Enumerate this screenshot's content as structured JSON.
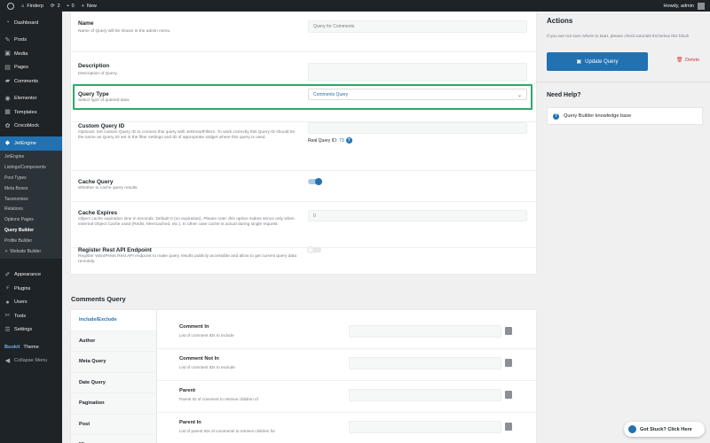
{
  "adminbar": {
    "site_name": "Finderp",
    "updates_count": "2",
    "comments_count": "0",
    "new_label": "New",
    "howdy": "Howdy, admin"
  },
  "sidebar": {
    "items": [
      {
        "label": "Dashboard",
        "icon": "dashboard-icon"
      },
      {
        "label": "Posts",
        "icon": "pin-icon"
      },
      {
        "label": "Media",
        "icon": "media-icon"
      },
      {
        "label": "Pages",
        "icon": "page-icon"
      },
      {
        "label": "Comments",
        "icon": "comment-icon"
      },
      {
        "label": "Elementor",
        "icon": "elementor-icon"
      },
      {
        "label": "Templates",
        "icon": "folder-icon"
      },
      {
        "label": "Crocoblock",
        "icon": "crocoblock-icon"
      },
      {
        "label": "JetEngine",
        "icon": "jetengine-icon"
      }
    ],
    "submenu": [
      "JetEngine",
      "Listings/Components",
      "Post Types",
      "Meta Boxes",
      "Taxonomies",
      "Relations",
      "Options Pages",
      "Query Builder",
      "Profile Builder",
      "Website Builder"
    ],
    "lower_items": [
      {
        "label": "Appearance",
        "icon": "brush-icon"
      },
      {
        "label": "Plugins",
        "icon": "plugin-icon"
      },
      {
        "label": "Users",
        "icon": "user-icon"
      },
      {
        "label": "Tools",
        "icon": "tools-icon"
      },
      {
        "label": "Settings",
        "icon": "settings-icon"
      }
    ],
    "theme_brand": "Bookit",
    "theme_label": "Theme",
    "collapse": "Collapse Menu"
  },
  "form": {
    "name_label": "Name",
    "name_desc": "Name of Query will be shown in the admin menu.",
    "name_placeholder": "Query for Comments",
    "description_label": "Description",
    "description_desc": "Description of Query.",
    "query_type_label": "Query Type",
    "query_type_desc": "Select type of queried data.",
    "query_type_value": "Comments Query",
    "custom_id_label": "Custom Query ID",
    "custom_id_desc": "Optional. Set custom Query ID to connect this query with JetSmartFilters. To work correctly this Query ID should be the same as Query ID set in the filter settings and ID of appropriate widget where this query is used.",
    "real_id_label": "Real Query ID:",
    "real_id_value": "73",
    "cache_label": "Cache Query",
    "cache_desc": "Whether to cache query results.",
    "cache_on": true,
    "expires_label": "Cache Expires",
    "expires_desc": "Object cache expiration time in seconds. Default 0 (no expiration). Please note: this option makes sence only when external Object Cache used (Redis, Memcached, etc.). In other case cache is actual during single request.",
    "expires_placeholder": "0",
    "rest_label": "Register Rest API Endpoint",
    "rest_desc": "Register WordPress Rest API endpoint to make query results publicly accessible and allow to get current query data remotely.",
    "rest_on": false
  },
  "actions": {
    "title": "Actions",
    "note": "If you are not sure where to start, please check tutorials list below this block",
    "update": "Update Query",
    "delete": "Delete",
    "help_title": "Need Help?",
    "help_link": "Query Builder knowledge base"
  },
  "comments_query": {
    "title": "Comments Query",
    "tabs": [
      "Include/Exclude",
      "Author",
      "Meta Query",
      "Date Query",
      "Pagination",
      "Post",
      "Misc"
    ],
    "rows": [
      {
        "label": "Comment In",
        "desc": "List of comment IDs to include"
      },
      {
        "label": "Comment Not In",
        "desc": "List of comment IDs to exclude"
      },
      {
        "label": "Parent",
        "desc": "Parent ID of comment to retrieve children of"
      },
      {
        "label": "Parent In",
        "desc": "List of parent IDs of comments to retrieve children for"
      }
    ]
  },
  "stuck": "Got Stuck? Click Here",
  "colors": {
    "accent": "#2271b1",
    "highlight": "#2eaa6a",
    "danger": "#d63638"
  }
}
